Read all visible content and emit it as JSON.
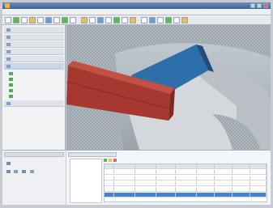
{
  "window": {
    "title": ""
  },
  "menu": {
    "items": [
      "",
      "",
      "",
      "",
      "",
      ""
    ]
  },
  "toolbar": {
    "button_count": 22
  },
  "left_panel": {
    "sections": [
      "",
      "",
      "",
      "",
      ""
    ],
    "active_section": "",
    "tree": [
      "",
      "",
      "",
      "",
      ""
    ]
  },
  "bottom_left": {
    "tabs": [
      "",
      ""
    ]
  },
  "bottom_right": {
    "tabs": [
      "",
      ""
    ],
    "columns": [
      "",
      "",
      "",
      "",
      "",
      "",
      "",
      ""
    ],
    "rows": [
      [
        "",
        "",
        "",
        "",
        "",
        "",
        "",
        ""
      ],
      [
        "",
        "",
        "",
        "",
        "",
        "",
        "",
        ""
      ],
      [
        "",
        "",
        "",
        "",
        "",
        "",
        "",
        ""
      ],
      [
        "",
        "",
        "",
        "",
        "",
        "",
        "",
        ""
      ],
      [
        "",
        "",
        "",
        "",
        "",
        "",
        "",
        ""
      ]
    ],
    "selected_row": 4
  },
  "colors": {
    "titlebar": "#3e6199",
    "beam_red": "#a83a30",
    "beam_blue": "#2e6fa8",
    "selection": "#3f82d6"
  },
  "icons": [
    "app-icon",
    "minimize-icon",
    "maximize-icon",
    "close-icon"
  ]
}
